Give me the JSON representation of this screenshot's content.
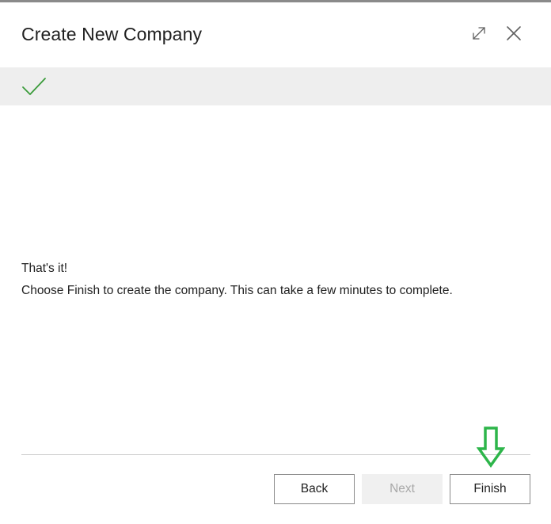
{
  "dialog": {
    "title": "Create New Company",
    "expand_icon": "expand-icon",
    "close_icon": "close-icon"
  },
  "step_bar": {
    "status_icon": "checkmark-icon",
    "accent_color": "#3a9b3a"
  },
  "content": {
    "heading": "That's it!",
    "body": "Choose Finish to create the company. This can take a few minutes to complete."
  },
  "footer": {
    "back_label": "Back",
    "next_label": "Next",
    "next_disabled": true,
    "finish_label": "Finish"
  },
  "annotation": {
    "icon": "down-arrow-icon",
    "color": "#2db54a"
  }
}
